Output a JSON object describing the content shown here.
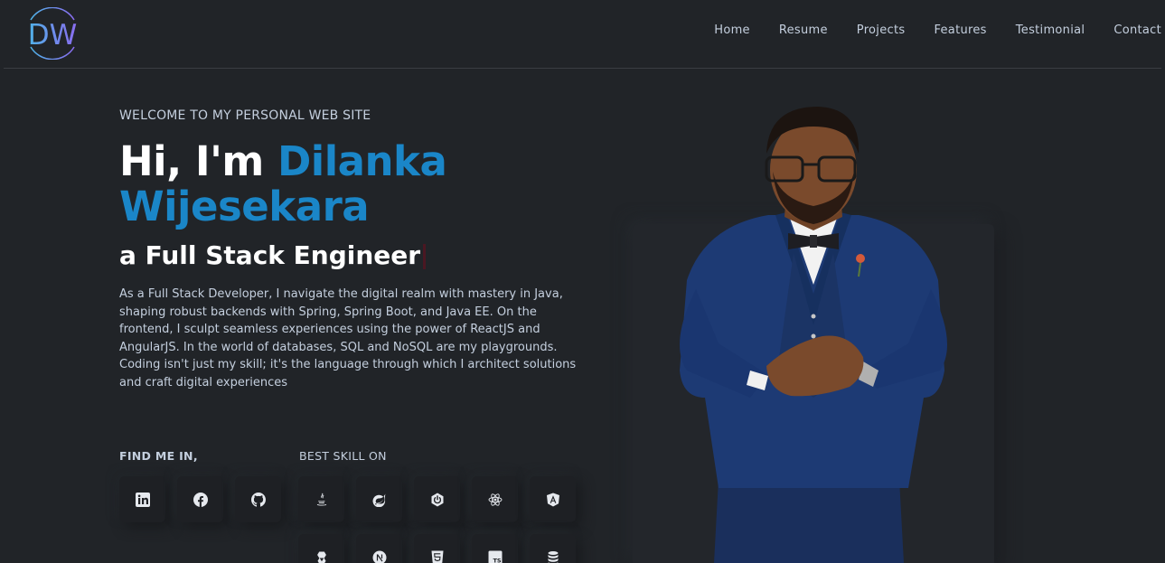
{
  "header": {
    "logo_text": "DW",
    "nav": [
      "Home",
      "Resume",
      "Projects",
      "Features",
      "Testimonial",
      "Contact"
    ]
  },
  "hero": {
    "welcome": "WELCOME TO MY PERSONAL WEB SITE",
    "greeting": "Hi, I'm",
    "first_name": "Dilanka",
    "last_name": "Wijesekara",
    "role": "a Full Stack Engineer",
    "bio": "As a Full Stack Developer, I navigate the digital realm with mastery in Java, shaping robust backends with Spring, Spring Boot, and Java EE. On the frontend, I sculpt seamless experiences using the power of ReactJS and AngularJS. In the world of databases, SQL and NoSQL are my playgrounds. Coding isn't just my skill; it's the language through which I architect solutions and craft digital experiences"
  },
  "social": {
    "label": "FIND ME IN,",
    "links": [
      "linkedin-icon",
      "facebook-icon",
      "github-icon"
    ]
  },
  "skills": {
    "label": "BEST SKILL ON",
    "icons": [
      "java-icon",
      "spring-icon",
      "spring-boot-icon",
      "react-icon",
      "angular-icon",
      "hibernate-icon",
      "nextjs-icon",
      "html5-icon",
      "typescript-icon",
      "database-icon"
    ]
  },
  "colors": {
    "background": "#212428",
    "accent": "#1a86c8",
    "text": "#c4cfde",
    "heading": "#ffffff"
  }
}
